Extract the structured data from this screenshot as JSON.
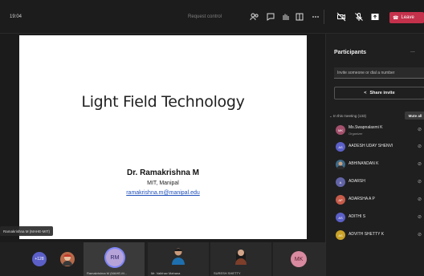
{
  "topbar": {
    "time": "19:04",
    "request_control": "Request control",
    "leave_label": "Leave"
  },
  "slide": {
    "title": "Light Field Technology",
    "author": "Dr. Ramakrishna M",
    "affiliation": "MIT, Manipal",
    "email": "ramakrishna.m@manipal.edu"
  },
  "presenter_tag": "Ramakrishna M (MAHE-MIT)",
  "gallery": {
    "overflow_count": "+128",
    "tiles": [
      {
        "initials": "RM",
        "name": "Ramakrishna M (MAHE-M..."
      },
      {
        "name": "Mr. Vaibhav Mahana"
      },
      {
        "name": "SURESH SHETTY"
      },
      {
        "initials": "MK"
      }
    ]
  },
  "participants": {
    "title": "Participants",
    "more": "...",
    "invite_placeholder": "Invite someone or dial a number",
    "share_invite": "Share invite",
    "in_meeting": "In this meeting (133)",
    "mute_all": "Mute all",
    "list": [
      {
        "initials": "MK",
        "name": "Ms.Swapnalaxmi K",
        "role": "Organizer",
        "color": "#a4506d"
      },
      {
        "initials": "AS",
        "name": "AADESH UDAY SHENVI",
        "role": "",
        "color": "#5b5fc7"
      },
      {
        "initials": "",
        "name": "ABHINANDAN K",
        "role": "",
        "color": "#3d6b8a"
      },
      {
        "initials": "A",
        "name": "ADARSH",
        "role": "",
        "color": "#6264a7"
      },
      {
        "initials": "AP",
        "name": "ADARSHA A P",
        "role": "",
        "color": "#c75b4a"
      },
      {
        "initials": "AS",
        "name": "ADITHI S",
        "role": "",
        "color": "#5b5fc7"
      },
      {
        "initials": "AS",
        "name": "ADVITH SHETTY K",
        "role": "",
        "color": "#c9a227"
      }
    ]
  }
}
